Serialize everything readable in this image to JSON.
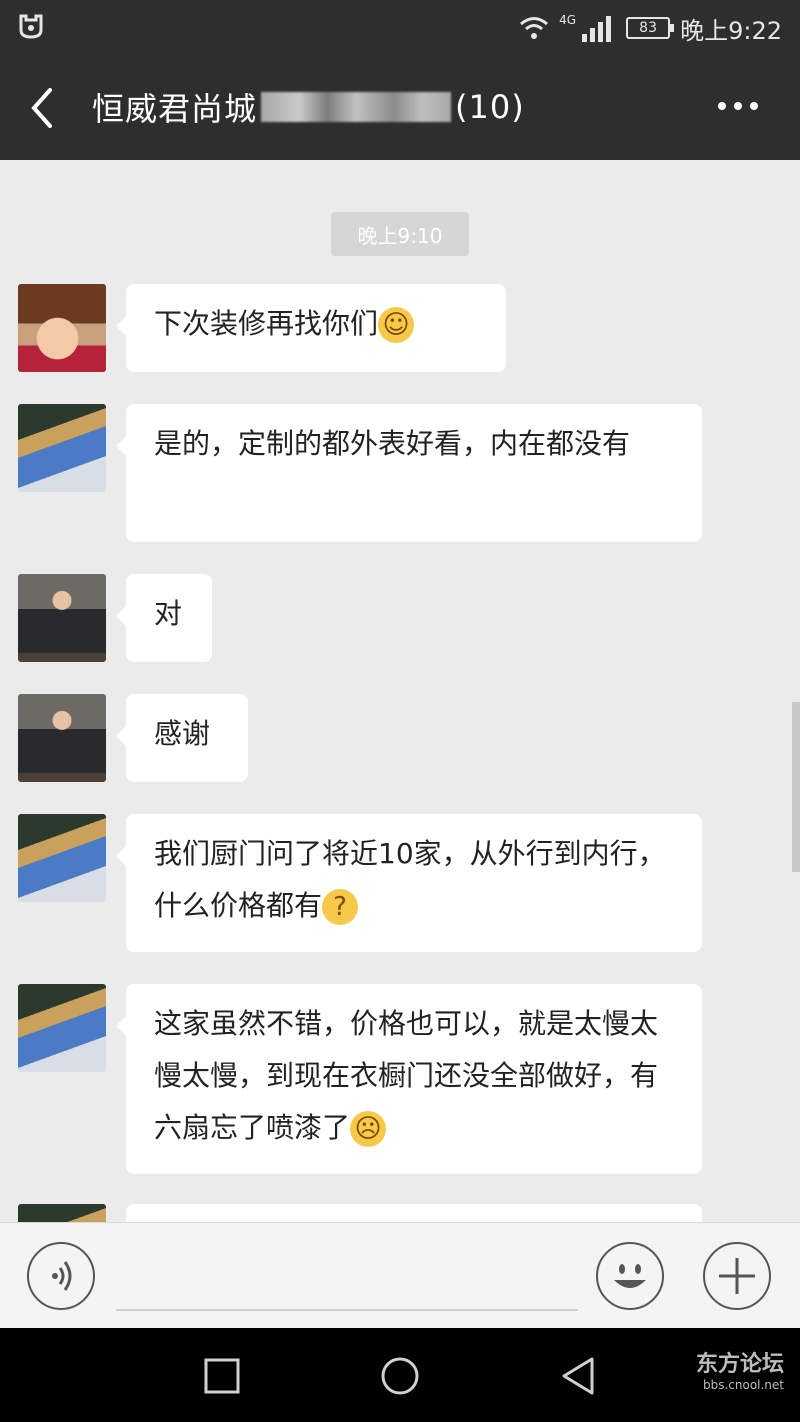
{
  "status_bar": {
    "network": "4G",
    "battery": "83",
    "time": "晚上9:22"
  },
  "header": {
    "title_prefix": "恒威君尚城",
    "title_suffix": "(10)"
  },
  "chat": {
    "timestamp": "晚上9:10",
    "messages": [
      {
        "text": "下次装修再找你们",
        "emoji": "smile-emoji"
      },
      {
        "text": "是的，定制的都外表好看，内在都没有"
      },
      {
        "text": "对"
      },
      {
        "text": "感谢"
      },
      {
        "text": "我们厨门问了将近10家，从外行到内行，什么价格都有",
        "emoji": "thinking-emoji"
      },
      {
        "text": "这家虽然不错，价格也可以，就是太慢太慢太慢，到现在衣橱门还没全部做好，有六扇忘了喷漆了",
        "emoji": "sad-emoji"
      }
    ]
  },
  "input_bar": {
    "voice_icon": "voice-icon",
    "emoji_icon": "emoji-icon",
    "add_icon": "plus-icon"
  },
  "watermark": {
    "name": "东方论坛",
    "site": "bbs.cnool.net"
  }
}
